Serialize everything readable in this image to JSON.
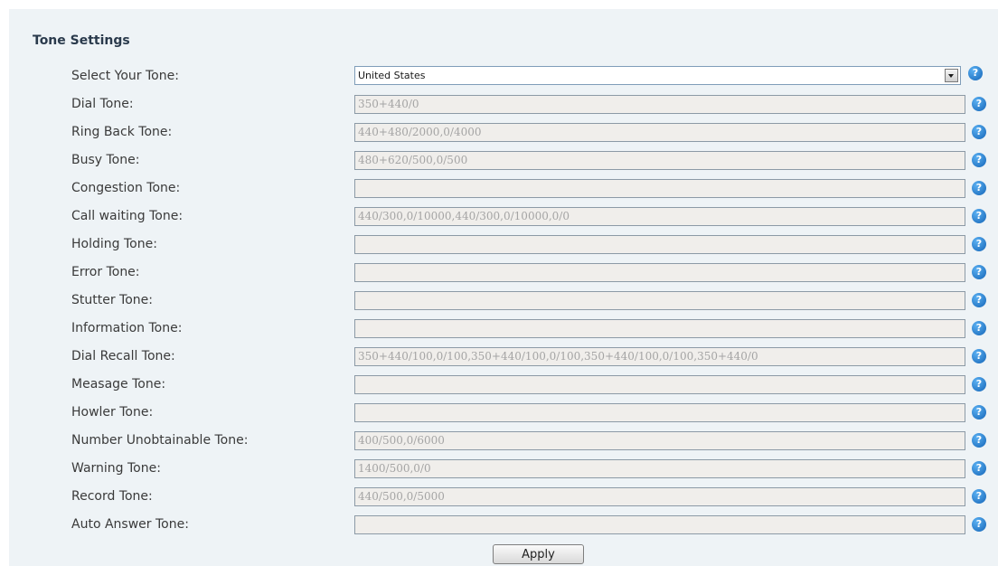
{
  "section": {
    "title": "Tone Settings"
  },
  "select_tone": {
    "label": "Select Your Tone:",
    "value": "United States"
  },
  "tones": [
    {
      "label": "Dial Tone:",
      "value": "350+440/0"
    },
    {
      "label": "Ring Back Tone:",
      "value": "440+480/2000,0/4000"
    },
    {
      "label": "Busy Tone:",
      "value": "480+620/500,0/500"
    },
    {
      "label": "Congestion Tone:",
      "value": ""
    },
    {
      "label": "Call waiting Tone:",
      "value": "440/300,0/10000,440/300,0/10000,0/0"
    },
    {
      "label": "Holding Tone:",
      "value": ""
    },
    {
      "label": "Error Tone:",
      "value": ""
    },
    {
      "label": "Stutter Tone:",
      "value": ""
    },
    {
      "label": "Information Tone:",
      "value": ""
    },
    {
      "label": "Dial Recall Tone:",
      "value": "350+440/100,0/100,350+440/100,0/100,350+440/100,0/100,350+440/0"
    },
    {
      "label": "Measage Tone:",
      "value": ""
    },
    {
      "label": "Howler Tone:",
      "value": ""
    },
    {
      "label": "Number Unobtainable Tone:",
      "value": "400/500,0/6000"
    },
    {
      "label": "Warning Tone:",
      "value": "1400/500,0/0"
    },
    {
      "label": "Record Tone:",
      "value": "440/500,0/5000"
    },
    {
      "label": "Auto Answer Tone:",
      "value": ""
    }
  ],
  "help_glyph": "?",
  "apply_label": "Apply",
  "icons": {
    "help": "help-icon",
    "dropdown": "chevron-down-icon"
  },
  "colors": {
    "panel_background": "#eef3f6",
    "help_icon": "#1e7fd8",
    "disabled_field": "#f0eeeb"
  }
}
